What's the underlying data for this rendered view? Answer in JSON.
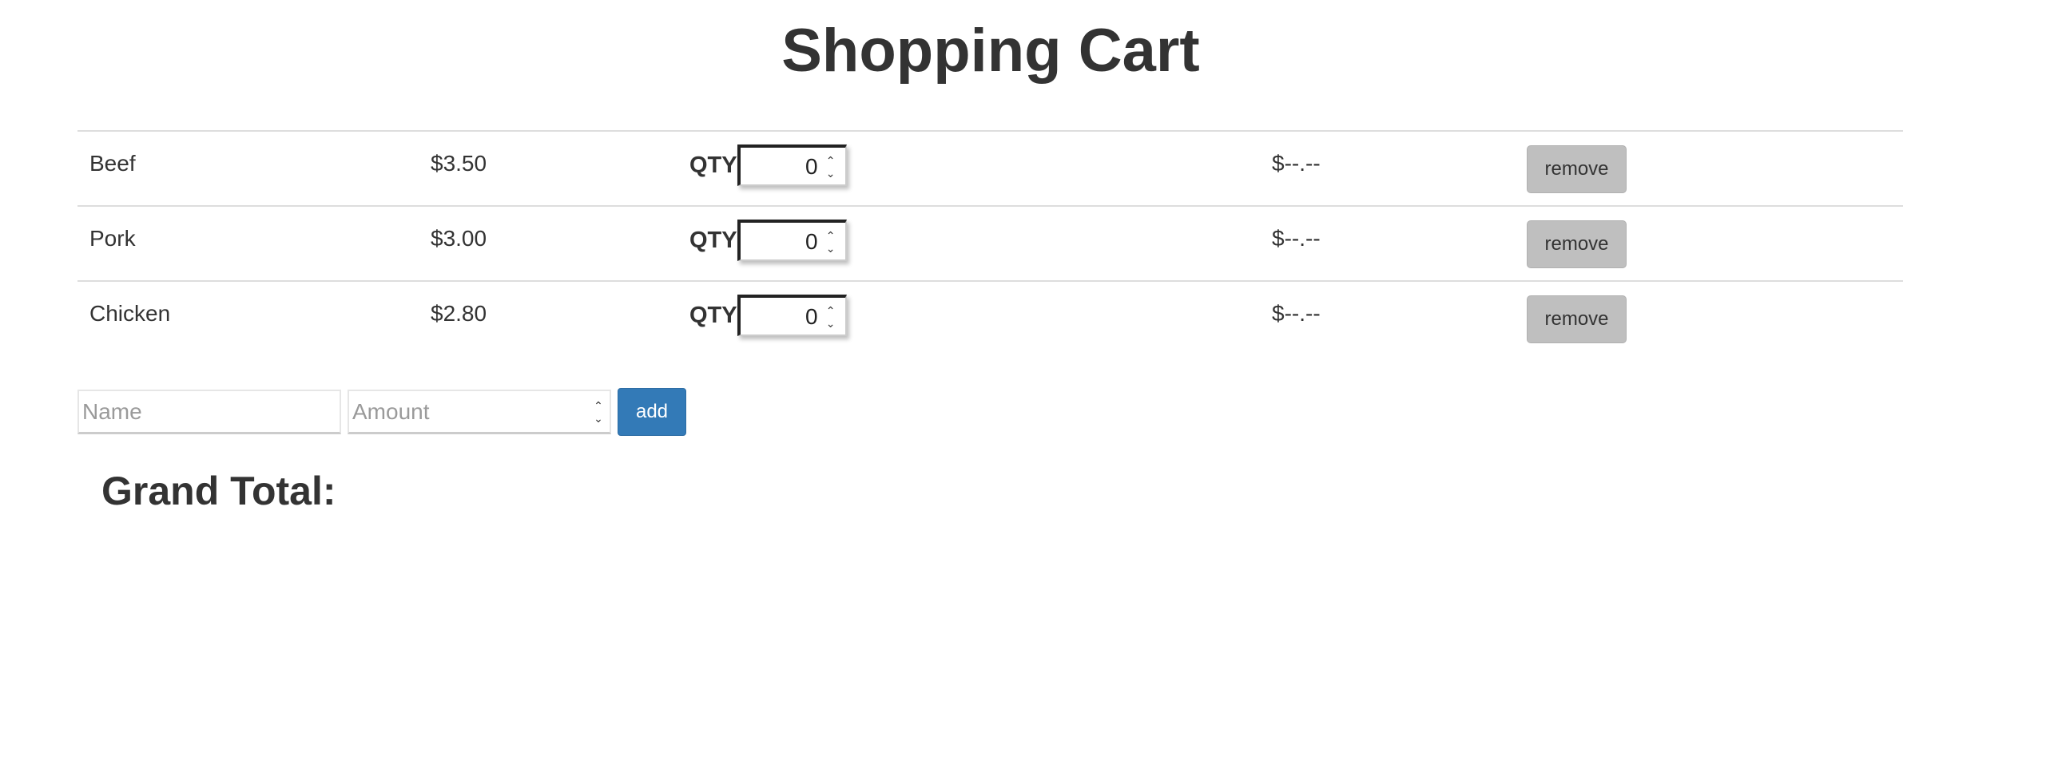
{
  "page": {
    "title": "Shopping Cart",
    "grand_total_label": "Grand Total:"
  },
  "cart": {
    "qty_label": "QTY",
    "remove_label": "remove",
    "items": [
      {
        "name": "Beef",
        "price": "$3.50",
        "qty": "0",
        "subtotal": "$--.--"
      },
      {
        "name": "Pork",
        "price": "$3.00",
        "qty": "0",
        "subtotal": "$--.--"
      },
      {
        "name": "Chicken",
        "price": "$2.80",
        "qty": "0",
        "subtotal": "$--.--"
      }
    ]
  },
  "add_form": {
    "name_placeholder": "Name",
    "amount_placeholder": "Amount",
    "add_label": "add"
  },
  "icons": {
    "spinner_up": "chevron-up-icon",
    "spinner_down": "chevron-down-icon"
  },
  "colors": {
    "add_button": "#337ab7",
    "remove_button": "#bfbfbf",
    "text": "#333333"
  }
}
